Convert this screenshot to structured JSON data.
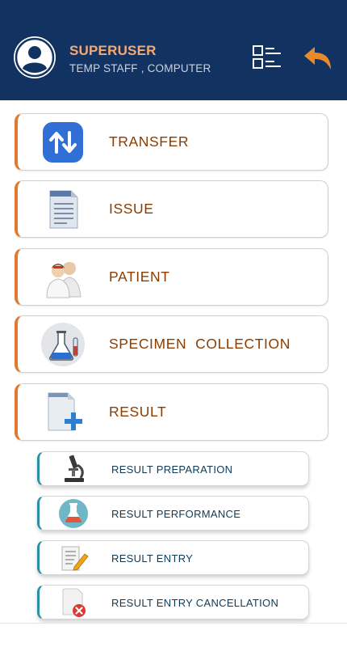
{
  "header": {
    "user_name": "SUPERUSER",
    "user_role": "TEMP STAFF , COMPUTER",
    "icons": {
      "avatar": "user-avatar-icon",
      "menu": "list-view-icon",
      "back": "back-arrow-icon"
    },
    "colors": {
      "background": "#123361",
      "name": "#f4a977",
      "back_arrow": "#e88a2b"
    }
  },
  "menu": {
    "items": [
      {
        "label": "TRANSFER",
        "icon": "transfer-arrows-icon"
      },
      {
        "label": "ISSUE",
        "icon": "document-icon"
      },
      {
        "label": "PATIENT",
        "icon": "patients-icon"
      },
      {
        "label": "SPECIMEN  COLLECTION",
        "icon": "flask-icon"
      },
      {
        "label": "RESULT",
        "icon": "document-add-icon"
      }
    ],
    "accent_color": "#e07a2e",
    "label_color": "#8b3c00"
  },
  "result_submenu": {
    "items": [
      {
        "label": "RESULT PREPARATION",
        "icon": "microscope-icon"
      },
      {
        "label": "RESULT PERFORMANCE",
        "icon": "lab-flask-icon"
      },
      {
        "label": "RESULT ENTRY",
        "icon": "notepad-pencil-icon"
      },
      {
        "label": "RESULT ENTRY CANCELLATION",
        "icon": "cancel-document-icon"
      }
    ],
    "accent_color": "#2c8fa3"
  }
}
